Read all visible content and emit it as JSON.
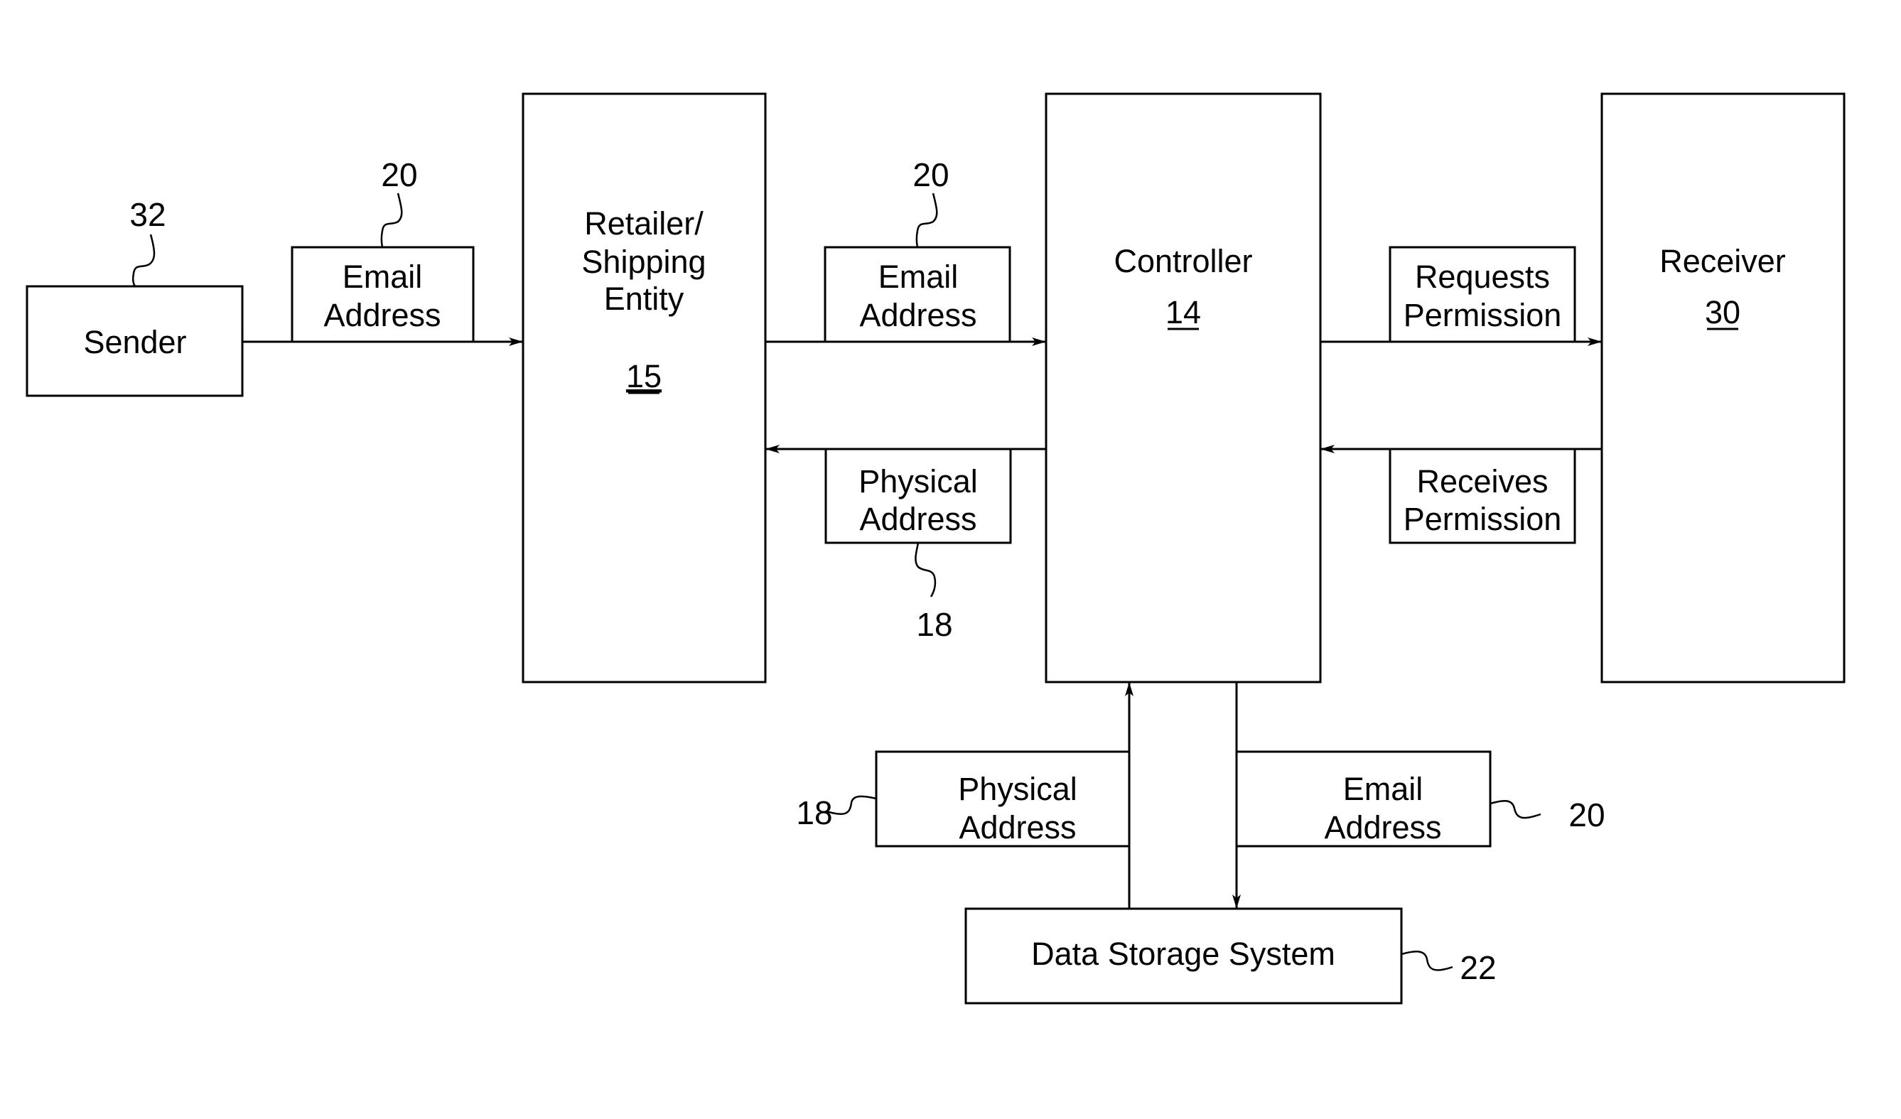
{
  "diagram": {
    "nodes": {
      "sender": {
        "label": "Sender",
        "ref": "32"
      },
      "retailer": {
        "lines": [
          "Retailer/",
          "Shipping",
          "Entity"
        ],
        "ref_underlined": "15"
      },
      "controller": {
        "label": "Controller",
        "ref_underlined": "14"
      },
      "receiver": {
        "label": "Receiver",
        "ref_underlined": "30"
      },
      "data_storage": {
        "label": "Data Storage System",
        "ref": "22"
      }
    },
    "messages": {
      "sender_to_retailer": {
        "lines": [
          "Email",
          "Address"
        ],
        "ref": "20",
        "direction": "sender → retailer"
      },
      "retailer_to_controller": {
        "lines": [
          "Email",
          "Address"
        ],
        "ref": "20",
        "direction": "retailer → controller"
      },
      "controller_to_retailer": {
        "lines": [
          "Physical",
          "Address"
        ],
        "ref": "18",
        "direction": "controller → retailer"
      },
      "controller_to_receiver": {
        "lines": [
          "Requests",
          "Permission"
        ],
        "direction": "controller → receiver"
      },
      "receiver_to_controller": {
        "lines": [
          "Receives",
          "Permission"
        ],
        "direction": "receiver → controller"
      },
      "storage_to_controller": {
        "lines": [
          "Physical",
          "Address"
        ],
        "ref": "18",
        "direction": "data storage → controller"
      },
      "controller_to_storage": {
        "lines": [
          "Email",
          "Address"
        ],
        "ref": "20",
        "direction": "controller → data storage"
      }
    }
  }
}
